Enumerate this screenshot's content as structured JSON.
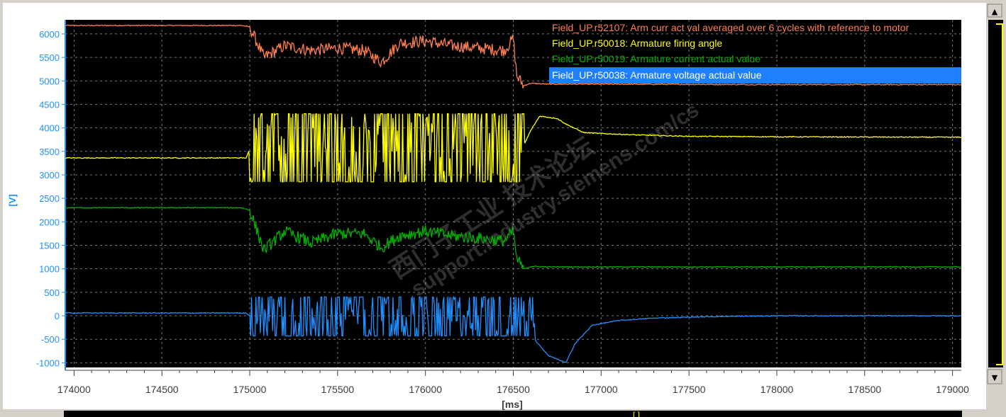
{
  "chart_data": {
    "type": "line",
    "x_unit": "[ms]",
    "y_unit": "[V]",
    "xlim": [
      173950,
      179050
    ],
    "ylim": [
      -1100,
      6300
    ],
    "x_ticks": [
      174000,
      174500,
      175000,
      175500,
      176000,
      176500,
      177000,
      177500,
      178000,
      178500,
      179000
    ],
    "y_ticks": [
      6000,
      5500,
      5000,
      4500,
      4000,
      3500,
      3000,
      2500,
      2000,
      1500,
      1000,
      500,
      0,
      -500,
      -1000
    ],
    "grid": true,
    "legend_placement": "top-right",
    "series": [
      {
        "name": "Field_UP.r52107: Arm curr act val averaged over 6 cycles with reference to motor",
        "color": "#ff7f50",
        "pattern": "noisy",
        "x": [
          173950,
          174950,
          175000,
          175080,
          175200,
          175350,
          175500,
          175650,
          175750,
          175850,
          176000,
          176150,
          176300,
          176450,
          176500,
          176520,
          176560,
          176600,
          176700,
          177000,
          178000,
          179050
        ],
        "y": [
          6180,
          6180,
          6150,
          5500,
          5750,
          5650,
          5700,
          5650,
          5400,
          5800,
          5850,
          5750,
          5700,
          5650,
          5900,
          5100,
          4900,
          4950,
          4930,
          4930,
          4920,
          4920
        ]
      },
      {
        "name": "Field_UP.r50018: Armature firing angle",
        "color": "#ffff00",
        "pattern": "square",
        "x": [
          173950,
          174980,
          175000,
          176550,
          176600,
          176650,
          176750,
          176800,
          176900,
          177000,
          177200,
          177500,
          178000,
          178500,
          179050
        ],
        "y": [
          3360,
          3360,
          3550,
          3550,
          3950,
          4250,
          4200,
          4080,
          3900,
          3880,
          3850,
          3820,
          3810,
          3805,
          3800
        ]
      },
      {
        "name": "Field_UP.r50019: Armature current actual value",
        "color": "#00b400",
        "pattern": "noisy",
        "x": [
          173950,
          174950,
          175000,
          175080,
          175200,
          175350,
          175500,
          175650,
          175750,
          175850,
          176000,
          176150,
          176300,
          176450,
          176500,
          176520,
          176560,
          176600,
          176700,
          177000,
          178000,
          179050
        ],
        "y": [
          2300,
          2300,
          2250,
          1400,
          1800,
          1550,
          1750,
          1750,
          1450,
          1700,
          1800,
          1700,
          1650,
          1600,
          1800,
          1200,
          1000,
          1050,
          1040,
          1040,
          1040,
          1040
        ]
      },
      {
        "name": "Field_UP.r50038: Armature voltage actual value",
        "color": "#1e90ff",
        "pattern": "square",
        "x": [
          173950,
          174980,
          175000,
          176600,
          176620,
          176700,
          176800,
          176850,
          176950,
          177100,
          177300,
          177600,
          178000,
          179050
        ],
        "y": [
          60,
          60,
          0,
          0,
          -500,
          -850,
          -1000,
          -600,
          -200,
          -100,
          -50,
          -20,
          0,
          0
        ]
      }
    ],
    "square_bands": [
      {
        "series": "Field_UP.r50018: Armature firing angle",
        "x_start": 175000,
        "x_end": 176560,
        "low": 2850,
        "high": 4300
      },
      {
        "series": "Field_UP.r50038: Armature voltage actual value",
        "x_start": 175000,
        "x_end": 176620,
        "low": -430,
        "high": 400
      }
    ],
    "selected_legend_index": 3
  },
  "ui": {
    "scroll_up": "▲",
    "scroll_down": "▼",
    "tooltip_glyph": "[ ]"
  },
  "colors": {
    "plot_bg": "#000000",
    "frame_bg": "#d4d0c8",
    "axis_text": "#1e90ff",
    "selection": "#1e7fff"
  }
}
